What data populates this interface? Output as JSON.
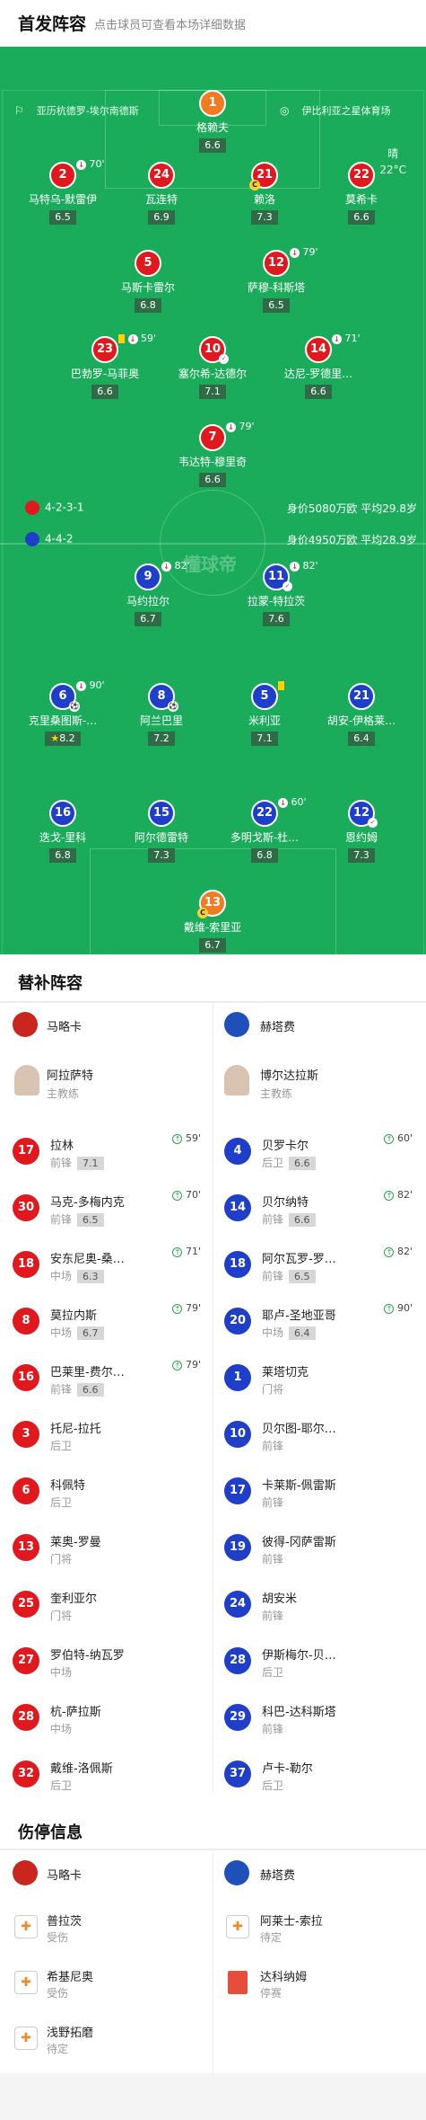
{
  "header": {
    "title": "首发阵容",
    "subtitle": "点击球员可查看本场详细数据"
  },
  "match": {
    "home_coach_label": "亚历杭德罗-埃尔南德斯",
    "stadium": "伊比利亚之星体育场",
    "weather": "晴",
    "temperature": "22°C",
    "watermark": "懂球帝"
  },
  "home": {
    "formation": "4-2-3-1",
    "value_line": "身价5080万欧 平均29.8岁",
    "color": "#e0191e"
  },
  "away": {
    "formation": "4-4-2",
    "value_line": "身价4950万欧 平均28.9岁",
    "color": "#1f3fc9"
  },
  "home_lineup": [
    {
      "num": "1",
      "name": "格赖夫",
      "rating": "6.6",
      "ev": ""
    },
    {
      "num": "2",
      "name": "马特乌-默雷伊",
      "rating": "6.5",
      "ev": "70'"
    },
    {
      "num": "24",
      "name": "瓦连特",
      "rating": "6.9",
      "ev": ""
    },
    {
      "num": "21",
      "name": "赖洛",
      "rating": "7.3",
      "ev": ""
    },
    {
      "num": "22",
      "name": "莫希卡",
      "rating": "6.6",
      "ev": ""
    },
    {
      "num": "5",
      "name": "马斯卡雷尔",
      "rating": "6.8",
      "ev": ""
    },
    {
      "num": "12",
      "name": "萨穆-科斯塔",
      "rating": "6.5",
      "ev": "79'"
    },
    {
      "num": "23",
      "name": "巴勃罗-马菲奥",
      "rating": "6.6",
      "ev": "59'"
    },
    {
      "num": "10",
      "name": "塞尔希-达德尔",
      "rating": "7.1",
      "ev": ""
    },
    {
      "num": "14",
      "name": "达尼-罗德里…",
      "rating": "6.6",
      "ev": "71'"
    },
    {
      "num": "7",
      "name": "韦达特-穆里奇",
      "rating": "6.6",
      "ev": "79'"
    }
  ],
  "away_lineup": [
    {
      "num": "9",
      "name": "马约拉尔",
      "rating": "6.7",
      "ev": "82'"
    },
    {
      "num": "11",
      "name": "拉蒙-特拉茨",
      "rating": "7.6",
      "ev": "82'"
    },
    {
      "num": "6",
      "name": "克里桑图斯-…",
      "rating": "8.2",
      "ev": "90'"
    },
    {
      "num": "8",
      "name": "阿兰巴里",
      "rating": "7.2",
      "ev": ""
    },
    {
      "num": "5",
      "name": "米利亚",
      "rating": "7.1",
      "ev": ""
    },
    {
      "num": "21",
      "name": "胡安-伊格莱…",
      "rating": "6.4",
      "ev": ""
    },
    {
      "num": "16",
      "name": "迭戈-里科",
      "rating": "6.8",
      "ev": ""
    },
    {
      "num": "15",
      "name": "阿尔德雷特",
      "rating": "7.3",
      "ev": ""
    },
    {
      "num": "22",
      "name": "多明戈斯-杜…",
      "rating": "6.8",
      "ev": "60'"
    },
    {
      "num": "12",
      "name": "恩约姆",
      "rating": "7.3",
      "ev": ""
    },
    {
      "num": "13",
      "name": "戴维-索里亚",
      "rating": "6.7",
      "ev": ""
    }
  ],
  "subs": {
    "title": "替补阵容",
    "home_team": "马略卡",
    "away_team": "赫塔费",
    "home_coach": {
      "name": "阿拉萨特",
      "role": "主教练"
    },
    "away_coach": {
      "name": "博尔达拉斯",
      "role": "主教练"
    },
    "home": [
      {
        "num": "17",
        "name": "拉林",
        "pos": "前锋",
        "rating": "7.1",
        "ev": "59'"
      },
      {
        "num": "30",
        "name": "马克-多梅内克",
        "pos": "前锋",
        "rating": "6.5",
        "ev": "70'"
      },
      {
        "num": "18",
        "name": "安东尼奥-桑…",
        "pos": "中场",
        "rating": "6.3",
        "ev": "71'"
      },
      {
        "num": "8",
        "name": "莫拉内斯",
        "pos": "中场",
        "rating": "6.7",
        "ev": "79'"
      },
      {
        "num": "16",
        "name": "巴莱里-费尔…",
        "pos": "前锋",
        "rating": "6.6",
        "ev": "79'"
      },
      {
        "num": "3",
        "name": "托尼-拉托",
        "pos": "后卫",
        "rating": "",
        "ev": ""
      },
      {
        "num": "6",
        "name": "科佩特",
        "pos": "后卫",
        "rating": "",
        "ev": ""
      },
      {
        "num": "13",
        "name": "莱奥-罗曼",
        "pos": "门将",
        "rating": "",
        "ev": ""
      },
      {
        "num": "25",
        "name": "奎利亚尔",
        "pos": "门将",
        "rating": "",
        "ev": ""
      },
      {
        "num": "27",
        "name": "罗伯特-纳瓦罗",
        "pos": "中场",
        "rating": "",
        "ev": ""
      },
      {
        "num": "28",
        "name": "杭-萨拉斯",
        "pos": "中场",
        "rating": "",
        "ev": ""
      },
      {
        "num": "32",
        "name": "戴维-洛佩斯",
        "pos": "后卫",
        "rating": "",
        "ev": ""
      }
    ],
    "away": [
      {
        "num": "4",
        "name": "贝罗卡尔",
        "pos": "后卫",
        "rating": "6.6",
        "ev": "60'"
      },
      {
        "num": "14",
        "name": "贝尔纳特",
        "pos": "前锋",
        "rating": "6.6",
        "ev": "82'"
      },
      {
        "num": "18",
        "name": "阿尔瓦罗-罗…",
        "pos": "前锋",
        "rating": "6.5",
        "ev": "82'"
      },
      {
        "num": "20",
        "name": "耶卢-圣地亚哥",
        "pos": "中场",
        "rating": "6.4",
        "ev": "90'"
      },
      {
        "num": "1",
        "name": "莱塔切克",
        "pos": "门将",
        "rating": "",
        "ev": ""
      },
      {
        "num": "10",
        "name": "贝尔图-耶尔…",
        "pos": "前锋",
        "rating": "",
        "ev": ""
      },
      {
        "num": "17",
        "name": "卡莱斯-佩雷斯",
        "pos": "前锋",
        "rating": "",
        "ev": ""
      },
      {
        "num": "19",
        "name": "彼得-冈萨雷斯",
        "pos": "前锋",
        "rating": "",
        "ev": ""
      },
      {
        "num": "24",
        "name": "胡安米",
        "pos": "前锋",
        "rating": "",
        "ev": ""
      },
      {
        "num": "28",
        "name": "伊斯梅尔-贝…",
        "pos": "后卫",
        "rating": "",
        "ev": ""
      },
      {
        "num": "29",
        "name": "科巴-达科斯塔",
        "pos": "前锋",
        "rating": "",
        "ev": ""
      },
      {
        "num": "37",
        "name": "卢卡-勒尔",
        "pos": "后卫",
        "rating": "",
        "ev": ""
      }
    ]
  },
  "injuries": {
    "title": "伤停信息",
    "home": [
      {
        "name": "普拉茨",
        "status": "受伤"
      },
      {
        "name": "希基尼奥",
        "status": "受伤"
      },
      {
        "name": "浅野拓磨",
        "status": "待定"
      }
    ],
    "away": [
      {
        "name": "阿莱士-索拉",
        "status": "待定"
      },
      {
        "name": "达科纳姆",
        "status": "停赛"
      }
    ]
  }
}
